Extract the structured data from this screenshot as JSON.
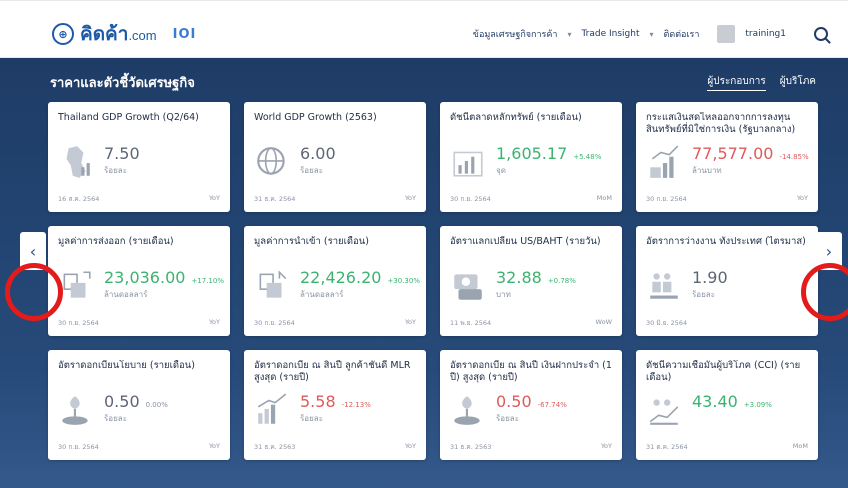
{
  "header": {
    "logo_mark": "⊕",
    "logo_text": "คิดค้า",
    "logo_suffix": ".com",
    "logo_badge": "IOI",
    "nav": [
      "ข้อมูลเศรษฐกิจการค้า",
      "Trade Insight",
      "ติดต่อเรา"
    ],
    "username": "training1"
  },
  "section": {
    "title": "ราคาและตัวชี้วัดเศรษฐกิจ",
    "toggle": [
      "ผู้ประกอบการ",
      "ผู้บริโภค"
    ]
  },
  "cards": [
    {
      "title": "Thailand GDP Growth (Q2/64)",
      "value": "7.50",
      "change": "",
      "unit": "ร้อยละ",
      "date": "16 ส.ค. 2564",
      "period": "YoY",
      "color": "gray",
      "icon": "map-icon"
    },
    {
      "title": "World GDP Growth (2563)",
      "value": "6.00",
      "change": "",
      "unit": "ร้อยละ",
      "date": "31 ธ.ค. 2564",
      "period": "YoY",
      "color": "gray",
      "icon": "globe-icon"
    },
    {
      "title": "ดัชนีตลาดหลักทรัพย์ (รายเดือน)",
      "value": "1,605.17",
      "change": "+5.48%",
      "unit": "จุด",
      "date": "30 ก.ย. 2564",
      "period": "MoM",
      "color": "green",
      "icon": "chart-icon"
    },
    {
      "title": "กระแสเงินสดไหลออกจากการลงทุนสินทรัพย์ที่มิใช่การเงิน (รัฐบาลกลาง)",
      "value": "77,577.00",
      "change": "-14.85%",
      "unit": "ล้านบาท",
      "date": "30 ก.ย. 2564",
      "period": "YoY",
      "color": "red",
      "icon": "money-growth-icon"
    },
    {
      "title": "มูลค่าการส่งออก (รายเดือน)",
      "value": "23,036.00",
      "change": "+17.10%",
      "unit": "ล้านดอลลาร์",
      "date": "30 ก.ย. 2564",
      "period": "YoY",
      "color": "green",
      "icon": "export-icon"
    },
    {
      "title": "มูลค่าการนำเข้า (รายเดือน)",
      "value": "22,426.20",
      "change": "+30.30%",
      "unit": "ล้านดอลลาร์",
      "date": "30 ก.ย. 2564",
      "period": "YoY",
      "color": "green",
      "icon": "import-icon"
    },
    {
      "title": "อัตราแลกเปลี่ยน US/BAHT (รายวัน)",
      "value": "32.88",
      "change": "+0.78%",
      "unit": "บาท",
      "date": "11 พ.ย. 2564",
      "period": "WoW",
      "color": "green",
      "icon": "exchange-icon"
    },
    {
      "title": "อัตราการว่างงาน ทั้งประเทศ (ไตรมาส)",
      "value": "1.90",
      "change": "",
      "unit": "ร้อยละ",
      "date": "30 มิ.ย. 2564",
      "period": "",
      "color": "gray",
      "icon": "people-icon"
    },
    {
      "title": "อัตราดอกเบี้ยนโยบาย (รายเดือน)",
      "value": "0.50",
      "change": "0.00%",
      "unit": "ร้อยละ",
      "date": "30 ก.ย. 2564",
      "period": "YoY",
      "color": "gray",
      "icon": "plant-coin-icon"
    },
    {
      "title": "อัตราดอกเบี้ย ณ สิ้นปี ลูกค้าชั้นดี MLR สูงสุด (รายปี)",
      "value": "5.58",
      "change": "-12.13%",
      "unit": "ร้อยละ",
      "date": "31 ธ.ค. 2563",
      "period": "YoY",
      "color": "red",
      "icon": "rate-up-icon"
    },
    {
      "title": "อัตราดอกเบี้ย ณ สิ้นปี เงินฝากประจำ (1 ปี) สูงสุด (รายปี)",
      "value": "0.50",
      "change": "-67.74%",
      "unit": "ร้อยละ",
      "date": "31 ธ.ค. 2563",
      "period": "YoY",
      "color": "red",
      "icon": "plant-coin-icon"
    },
    {
      "title": "ดัชนีความเชื่อมั่นผู้บริโภค (CCI) (รายเดือน)",
      "value": "43.40",
      "change": "+3.09%",
      "unit": "",
      "date": "31 ต.ค. 2564",
      "period": "MoM",
      "color": "green",
      "icon": "people-growth-icon"
    }
  ],
  "arrows": {
    "prev": "‹",
    "next": "›"
  },
  "colors": {
    "green": "#3cb371",
    "red": "#e05a5a",
    "gray": "#5d6676",
    "brand": "#1c5aa8"
  }
}
